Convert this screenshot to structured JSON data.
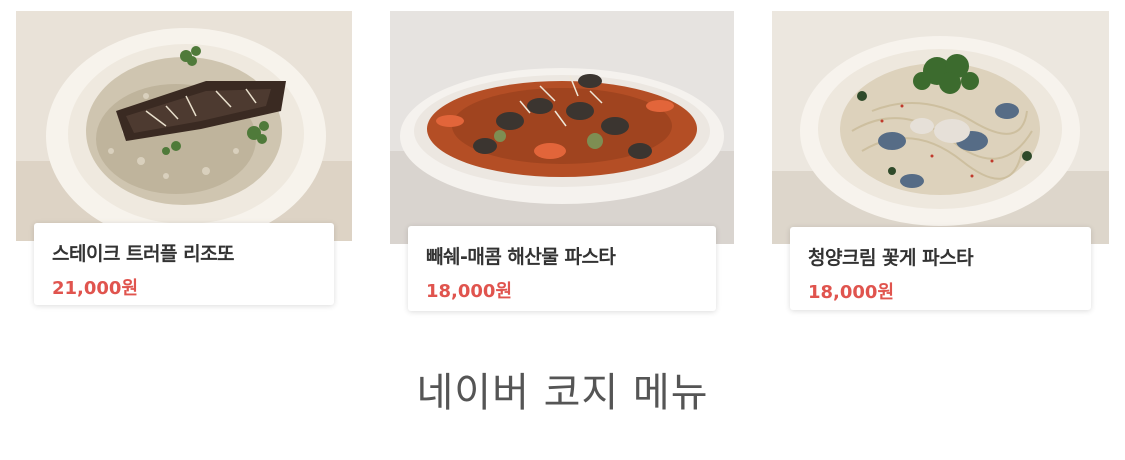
{
  "menu_items": [
    {
      "name": "스테이크 트러플 리조또",
      "price": "21,000원",
      "photo": "steak-risotto-photo"
    },
    {
      "name": "빼쉐-매콤 해산물 파스타",
      "price": "18,000원",
      "photo": "spicy-seafood-pasta-photo"
    },
    {
      "name": "청양크림 꽃게 파스타",
      "price": "18,000원",
      "photo": "crab-cream-pasta-photo"
    }
  ],
  "section": {
    "title": "네이버 코지 메뉴"
  },
  "colors": {
    "price": "#e0544e",
    "name": "#333333",
    "title": "#555555"
  }
}
